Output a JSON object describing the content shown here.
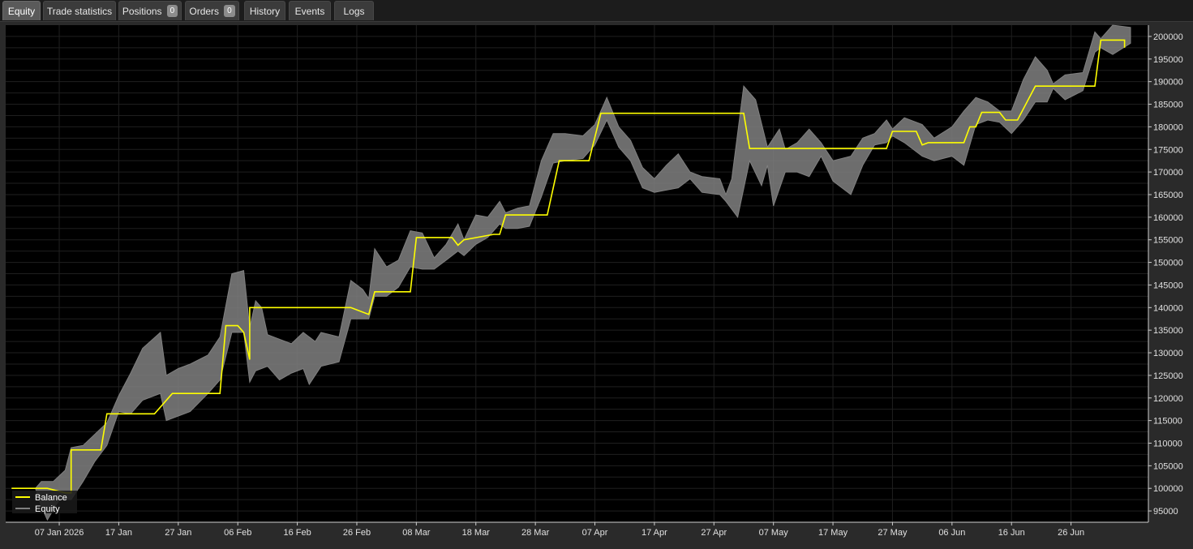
{
  "tabs": [
    {
      "label": "Equity",
      "active": true
    },
    {
      "label": "Trade statistics"
    },
    {
      "label": "Positions",
      "badge": "0"
    },
    {
      "label": "Orders",
      "badge": "0"
    },
    {
      "label": "History"
    },
    {
      "label": "Events"
    },
    {
      "label": "Logs"
    }
  ],
  "colors": {
    "balance": "#ffff00",
    "equity_band": "#808080",
    "background": "#000000",
    "grid": "#1f1f1f"
  },
  "chart_data": {
    "type": "line",
    "title": "",
    "xlabel": "",
    "ylabel": "",
    "ylim": [
      92500,
      202500
    ],
    "xlim": [
      "2025-12-29",
      "2026-07-09"
    ],
    "grid": true,
    "legend_position": "bottom-left",
    "x_ticks": [
      "07 Jan 2026",
      "17 Jan",
      "27 Jan",
      "06 Feb",
      "16 Feb",
      "26 Feb",
      "08 Mar",
      "18 Mar",
      "28 Mar",
      "07 Apr",
      "17 Apr",
      "27 Apr",
      "07 May",
      "17 May",
      "27 May",
      "06 Jun",
      "16 Jun",
      "26 Jun"
    ],
    "y_ticks": [
      95000,
      100000,
      105000,
      110000,
      115000,
      120000,
      125000,
      130000,
      135000,
      140000,
      145000,
      150000,
      155000,
      160000,
      165000,
      170000,
      175000,
      180000,
      185000,
      190000,
      195000,
      200000
    ],
    "series": [
      {
        "name": "Balance",
        "type": "step-line",
        "color": "#ffff00",
        "points": [
          [
            "2025-12-30",
            100000
          ],
          [
            "2026-01-03",
            100000
          ],
          [
            "2026-01-05",
            100000
          ],
          [
            "2026-01-08",
            99000
          ],
          [
            "2026-01-09",
            99000
          ],
          [
            "2026-01-09",
            108500
          ],
          [
            "2026-01-14",
            108500
          ],
          [
            "2026-01-15",
            116500
          ],
          [
            "2026-01-23",
            116500
          ],
          [
            "2026-01-26",
            121000
          ],
          [
            "2026-02-03",
            121000
          ],
          [
            "2026-02-04",
            136000
          ],
          [
            "2026-02-06",
            136000
          ],
          [
            "2026-02-07",
            134500
          ],
          [
            "2026-02-08",
            128500
          ],
          [
            "2026-02-08",
            140000
          ],
          [
            "2026-02-25",
            140000
          ],
          [
            "2026-02-28",
            138500
          ],
          [
            "2026-03-01",
            143500
          ],
          [
            "2026-03-07",
            143500
          ],
          [
            "2026-03-08",
            155500
          ],
          [
            "2026-03-14",
            155500
          ],
          [
            "2026-03-15",
            153800
          ],
          [
            "2026-03-16",
            155000
          ],
          [
            "2026-03-21",
            156200
          ],
          [
            "2026-03-22",
            156200
          ],
          [
            "2026-03-23",
            160500
          ],
          [
            "2026-03-30",
            160500
          ],
          [
            "2026-04-01",
            172500
          ],
          [
            "2026-04-06",
            172500
          ],
          [
            "2026-04-08",
            183000
          ],
          [
            "2026-05-02",
            183000
          ],
          [
            "2026-05-03",
            175200
          ],
          [
            "2026-05-26",
            175200
          ],
          [
            "2026-05-27",
            179000
          ],
          [
            "2026-05-31",
            179000
          ],
          [
            "2026-06-01",
            176000
          ],
          [
            "2026-06-02",
            176500
          ],
          [
            "2026-06-08",
            176500
          ],
          [
            "2026-06-09",
            180000
          ],
          [
            "2026-06-10",
            180000
          ],
          [
            "2026-06-11",
            183200
          ],
          [
            "2026-06-14",
            183200
          ],
          [
            "2026-06-15",
            181500
          ],
          [
            "2026-06-17",
            181500
          ],
          [
            "2026-06-20",
            189000
          ],
          [
            "2026-06-30",
            189000
          ],
          [
            "2026-07-01",
            199200
          ],
          [
            "2026-07-05",
            199200
          ],
          [
            "2026-07-05",
            197500
          ]
        ]
      },
      {
        "name": "Equity",
        "type": "band",
        "color": "#808080",
        "upper": [
          [
            "2025-12-30",
            100000
          ],
          [
            "2026-01-03",
            100000
          ],
          [
            "2026-01-04",
            101500
          ],
          [
            "2026-01-06",
            101500
          ],
          [
            "2026-01-08",
            104000
          ],
          [
            "2026-01-09",
            109000
          ],
          [
            "2026-01-11",
            109500
          ],
          [
            "2026-01-13",
            112000
          ],
          [
            "2026-01-15",
            114500
          ],
          [
            "2026-01-17",
            120500
          ],
          [
            "2026-01-19",
            125500
          ],
          [
            "2026-01-21",
            131000
          ],
          [
            "2026-01-24",
            134500
          ],
          [
            "2026-01-25",
            125000
          ],
          [
            "2026-01-27",
            126500
          ],
          [
            "2026-01-29",
            127500
          ],
          [
            "2026-02-01",
            129500
          ],
          [
            "2026-02-03",
            133500
          ],
          [
            "2026-02-05",
            147500
          ],
          [
            "2026-02-07",
            148200
          ],
          [
            "2026-02-08",
            135500
          ],
          [
            "2026-02-09",
            141500
          ],
          [
            "2026-02-10",
            140000
          ],
          [
            "2026-02-11",
            134000
          ],
          [
            "2026-02-13",
            133000
          ],
          [
            "2026-02-15",
            132000
          ],
          [
            "2026-02-17",
            134500
          ],
          [
            "2026-02-19",
            132500
          ],
          [
            "2026-02-20",
            134500
          ],
          [
            "2026-02-23",
            133500
          ],
          [
            "2026-02-25",
            146000
          ],
          [
            "2026-02-27",
            144000
          ],
          [
            "2026-02-28",
            142000
          ],
          [
            "2026-03-01",
            153000
          ],
          [
            "2026-03-03",
            149000
          ],
          [
            "2026-03-05",
            150500
          ],
          [
            "2026-03-07",
            157000
          ],
          [
            "2026-03-09",
            156500
          ],
          [
            "2026-03-11",
            151000
          ],
          [
            "2026-03-13",
            154000
          ],
          [
            "2026-03-15",
            158500
          ],
          [
            "2026-03-16",
            155000
          ],
          [
            "2026-03-18",
            160500
          ],
          [
            "2026-03-20",
            160000
          ],
          [
            "2026-03-22",
            163500
          ],
          [
            "2026-03-23",
            161000
          ],
          [
            "2026-03-25",
            162000
          ],
          [
            "2026-03-27",
            162500
          ],
          [
            "2026-03-29",
            172500
          ],
          [
            "2026-03-31",
            178500
          ],
          [
            "2026-04-02",
            178500
          ],
          [
            "2026-04-05",
            178000
          ],
          [
            "2026-04-07",
            180500
          ],
          [
            "2026-04-09",
            186500
          ],
          [
            "2026-04-11",
            180000
          ],
          [
            "2026-04-13",
            177000
          ],
          [
            "2026-04-15",
            171000
          ],
          [
            "2026-04-17",
            168500
          ],
          [
            "2026-04-19",
            171500
          ],
          [
            "2026-04-21",
            174000
          ],
          [
            "2026-04-23",
            170000
          ],
          [
            "2026-04-25",
            169000
          ],
          [
            "2026-04-28",
            168500
          ],
          [
            "2026-04-29",
            165000
          ],
          [
            "2026-04-30",
            168500
          ],
          [
            "2026-05-02",
            189000
          ],
          [
            "2026-05-04",
            186000
          ],
          [
            "2026-05-06",
            175500
          ],
          [
            "2026-05-08",
            179500
          ],
          [
            "2026-05-09",
            175000
          ],
          [
            "2026-05-11",
            176500
          ],
          [
            "2026-05-13",
            179500
          ],
          [
            "2026-05-15",
            176500
          ],
          [
            "2026-05-17",
            172500
          ],
          [
            "2026-05-20",
            173500
          ],
          [
            "2026-05-22",
            177500
          ],
          [
            "2026-05-24",
            178500
          ],
          [
            "2026-05-26",
            181500
          ],
          [
            "2026-05-27",
            179500
          ],
          [
            "2026-05-29",
            182000
          ],
          [
            "2026-06-01",
            180500
          ],
          [
            "2026-06-03",
            177500
          ],
          [
            "2026-06-06",
            180000
          ],
          [
            "2026-06-08",
            183500
          ],
          [
            "2026-06-10",
            186500
          ],
          [
            "2026-06-12",
            185500
          ],
          [
            "2026-06-14",
            183500
          ],
          [
            "2026-06-16",
            183500
          ],
          [
            "2026-06-18",
            190500
          ],
          [
            "2026-06-20",
            195500
          ],
          [
            "2026-06-22",
            192500
          ],
          [
            "2026-06-23",
            189500
          ],
          [
            "2026-06-25",
            191500
          ],
          [
            "2026-06-28",
            192000
          ],
          [
            "2026-06-30",
            201000
          ],
          [
            "2026-07-01",
            199500
          ],
          [
            "2026-07-03",
            202500
          ],
          [
            "2026-07-06",
            202000
          ]
        ],
        "lower": [
          [
            "2025-12-30",
            100000
          ],
          [
            "2026-01-03",
            100000
          ],
          [
            "2026-01-04",
            96000
          ],
          [
            "2026-01-05",
            93000
          ],
          [
            "2026-01-07",
            97500
          ],
          [
            "2026-01-09",
            97500
          ],
          [
            "2026-01-11",
            101500
          ],
          [
            "2026-01-13",
            106000
          ],
          [
            "2026-01-15",
            109500
          ],
          [
            "2026-01-17",
            117000
          ],
          [
            "2026-01-19",
            116500
          ],
          [
            "2026-01-21",
            119500
          ],
          [
            "2026-01-24",
            121000
          ],
          [
            "2026-01-25",
            115000
          ],
          [
            "2026-01-27",
            116000
          ],
          [
            "2026-01-29",
            117000
          ],
          [
            "2026-02-01",
            121000
          ],
          [
            "2026-02-03",
            124000
          ],
          [
            "2026-02-05",
            134500
          ],
          [
            "2026-02-07",
            134500
          ],
          [
            "2026-02-08",
            123500
          ],
          [
            "2026-02-09",
            126000
          ],
          [
            "2026-02-11",
            127000
          ],
          [
            "2026-02-13",
            124000
          ],
          [
            "2026-02-15",
            125500
          ],
          [
            "2026-02-17",
            126500
          ],
          [
            "2026-02-18",
            123000
          ],
          [
            "2026-02-20",
            127000
          ],
          [
            "2026-02-23",
            128000
          ],
          [
            "2026-02-25",
            137500
          ],
          [
            "2026-02-27",
            137500
          ],
          [
            "2026-02-28",
            137500
          ],
          [
            "2026-03-01",
            142500
          ],
          [
            "2026-03-03",
            142500
          ],
          [
            "2026-03-05",
            144500
          ],
          [
            "2026-03-07",
            149000
          ],
          [
            "2026-03-09",
            148500
          ],
          [
            "2026-03-11",
            148500
          ],
          [
            "2026-03-13",
            150500
          ],
          [
            "2026-03-15",
            152500
          ],
          [
            "2026-03-16",
            151500
          ],
          [
            "2026-03-18",
            154000
          ],
          [
            "2026-03-20",
            155500
          ],
          [
            "2026-03-22",
            158500
          ],
          [
            "2026-03-23",
            157500
          ],
          [
            "2026-03-25",
            157500
          ],
          [
            "2026-03-27",
            158000
          ],
          [
            "2026-03-29",
            164500
          ],
          [
            "2026-03-31",
            172000
          ],
          [
            "2026-04-02",
            172500
          ],
          [
            "2026-04-05",
            173000
          ],
          [
            "2026-04-07",
            176000
          ],
          [
            "2026-04-09",
            181500
          ],
          [
            "2026-04-11",
            175500
          ],
          [
            "2026-04-13",
            172500
          ],
          [
            "2026-04-15",
            166500
          ],
          [
            "2026-04-17",
            165500
          ],
          [
            "2026-04-19",
            166000
          ],
          [
            "2026-04-21",
            166500
          ],
          [
            "2026-04-23",
            168500
          ],
          [
            "2026-04-25",
            165500
          ],
          [
            "2026-04-28",
            165000
          ],
          [
            "2026-04-29",
            163500
          ],
          [
            "2026-05-01",
            160000
          ],
          [
            "2026-05-03",
            172500
          ],
          [
            "2026-05-05",
            167000
          ],
          [
            "2026-05-06",
            171500
          ],
          [
            "2026-05-07",
            162500
          ],
          [
            "2026-05-09",
            170000
          ],
          [
            "2026-05-11",
            170000
          ],
          [
            "2026-05-13",
            169000
          ],
          [
            "2026-05-15",
            173500
          ],
          [
            "2026-05-17",
            168000
          ],
          [
            "2026-05-20",
            165000
          ],
          [
            "2026-05-22",
            171500
          ],
          [
            "2026-05-24",
            176000
          ],
          [
            "2026-05-26",
            176500
          ],
          [
            "2026-05-27",
            178000
          ],
          [
            "2026-05-29",
            176500
          ],
          [
            "2026-06-01",
            173500
          ],
          [
            "2026-06-03",
            172500
          ],
          [
            "2026-06-06",
            173500
          ],
          [
            "2026-06-08",
            171500
          ],
          [
            "2026-06-10",
            180500
          ],
          [
            "2026-06-12",
            181500
          ],
          [
            "2026-06-14",
            181000
          ],
          [
            "2026-06-16",
            178500
          ],
          [
            "2026-06-18",
            181500
          ],
          [
            "2026-06-20",
            185500
          ],
          [
            "2026-06-22",
            185500
          ],
          [
            "2026-06-23",
            188500
          ],
          [
            "2026-06-25",
            186000
          ],
          [
            "2026-06-28",
            188000
          ],
          [
            "2026-06-30",
            196500
          ],
          [
            "2026-07-01",
            197500
          ],
          [
            "2026-07-03",
            196000
          ],
          [
            "2026-07-06",
            198500
          ]
        ]
      }
    ]
  }
}
